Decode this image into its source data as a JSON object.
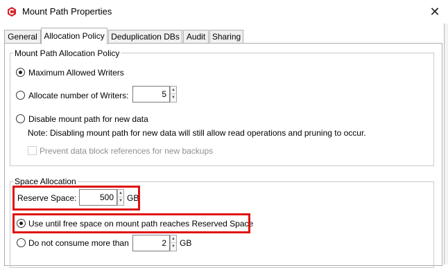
{
  "window": {
    "title": "Mount Path Properties",
    "close_glyph": "✕",
    "icon": "app-logo-icon",
    "accent": "#e01010"
  },
  "tabs": [
    {
      "label": "General",
      "active": false
    },
    {
      "label": "Allocation Policy",
      "active": true
    },
    {
      "label": "Deduplication DBs",
      "active": false
    },
    {
      "label": "Audit",
      "active": false
    },
    {
      "label": "Sharing",
      "active": false
    }
  ],
  "allocation_policy": {
    "legend": "Mount Path Allocation Policy",
    "max_writers_label": "Maximum Allowed Writers",
    "allocate_writers_label": "Allocate number of Writers:",
    "writers_value": "5",
    "disable_label": "Disable mount path for new data",
    "note": "Note: Disabling mount path for new data will still allow read operations and pruning to occur.",
    "prevent_label": "Prevent data block references for new backups"
  },
  "space_allocation": {
    "legend": "Space Allocation",
    "reserve_label": "Reserve Space:",
    "reserve_value": "500",
    "reserve_unit": "GB",
    "use_until_label": "Use until free space on mount path reaches Reserved Space",
    "do_not_consume_label": "Do not consume more than",
    "consume_value": "2",
    "consume_unit": "GB"
  }
}
